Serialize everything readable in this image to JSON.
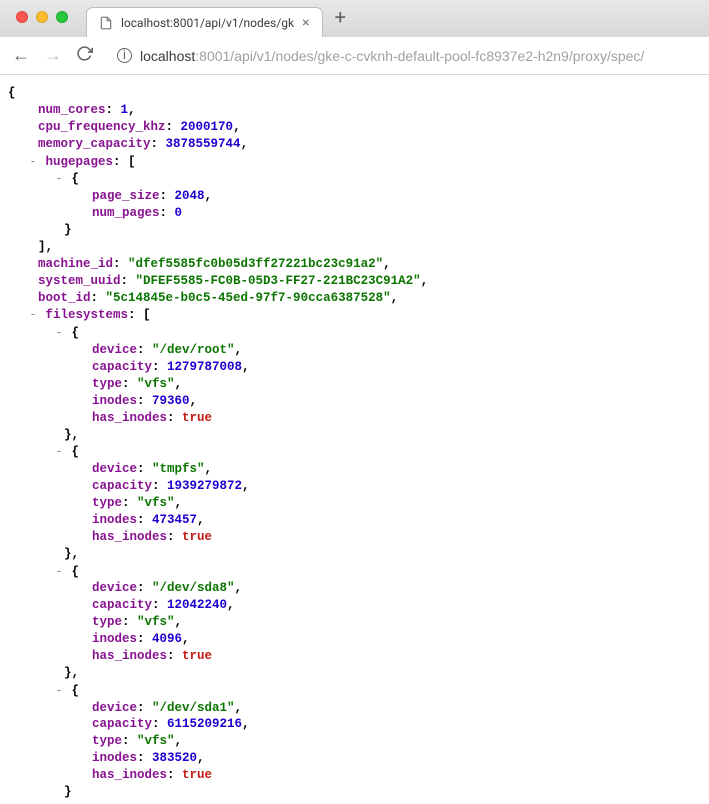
{
  "chrome": {
    "tab_title": "localhost:8001/api/v1/nodes/gk",
    "url_host": "localhost",
    "url_port_path": ":8001/api/v1/nodes/gke-c-cvknh-default-pool-fc8937e2-h2n9/proxy/spec/"
  },
  "json": {
    "num_cores": 1,
    "cpu_frequency_khz": 2000170,
    "memory_capacity": 3878559744,
    "hugepages": [
      {
        "page_size": 2048,
        "num_pages": 0
      }
    ],
    "machine_id": "\"dfef5585fc0b05d3ff27221bc23c91a2\"",
    "system_uuid": "\"DFEF5585-FC0B-05D3-FF27-221BC23C91A2\"",
    "boot_id": "\"5c14845e-b0c5-45ed-97f7-90cca6387528\"",
    "filesystems": [
      {
        "device": "\"/dev/root\"",
        "capacity": 1279787008,
        "type": "\"vfs\"",
        "inodes": 79360,
        "has_inodes": "true"
      },
      {
        "device": "\"tmpfs\"",
        "capacity": 1939279872,
        "type": "\"vfs\"",
        "inodes": 473457,
        "has_inodes": "true"
      },
      {
        "device": "\"/dev/sda8\"",
        "capacity": 12042240,
        "type": "\"vfs\"",
        "inodes": 4096,
        "has_inodes": "true"
      },
      {
        "device": "\"/dev/sda1\"",
        "capacity": 6115209216,
        "type": "\"vfs\"",
        "inodes": 383520,
        "has_inodes": "true"
      }
    ]
  },
  "labels": {
    "num_cores": "num_cores",
    "cpu_frequency_khz": "cpu_frequency_khz",
    "memory_capacity": "memory_capacity",
    "hugepages": "hugepages",
    "page_size": "page_size",
    "num_pages": "num_pages",
    "machine_id": "machine_id",
    "system_uuid": "system_uuid",
    "boot_id": "boot_id",
    "filesystems": "filesystems",
    "device": "device",
    "capacity": "capacity",
    "type": "type",
    "inodes": "inodes",
    "has_inodes": "has_inodes"
  }
}
